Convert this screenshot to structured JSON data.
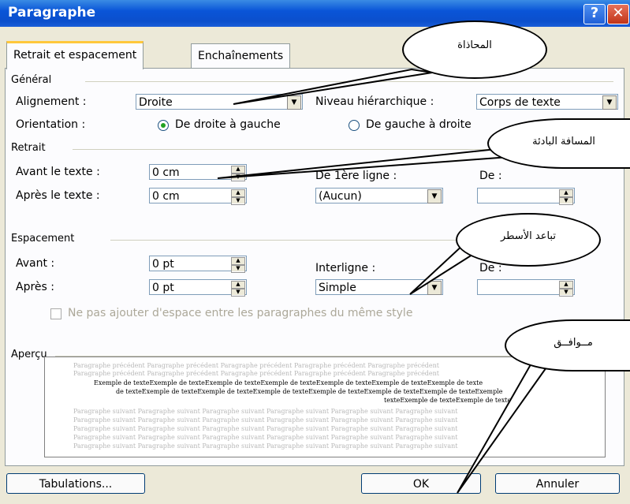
{
  "window": {
    "title": "Paragraphe",
    "help_glyph": "?",
    "close_glyph": "✕"
  },
  "tabs": [
    {
      "label": "Retrait et espacement",
      "active": true
    },
    {
      "label": "Enchaînements",
      "active": false
    }
  ],
  "general": {
    "group_label": "Général",
    "alignment_label": "Alignement :",
    "alignment_value": "Droite",
    "level_label": "Niveau hiérarchique :",
    "level_value": "Corps de texte",
    "orientation_label": "Orientation :",
    "orientation_rtl": "De droite à gauche",
    "orientation_ltr": "De gauche à droite"
  },
  "indent": {
    "group_label": "Retrait",
    "before_label": "Avant le texte :",
    "before_value": "0 cm",
    "after_label": "Après le texte :",
    "after_value": "0 cm",
    "first_line_label": "De 1ère ligne :",
    "first_line_value": "(Aucun)",
    "by_label": "De :",
    "by_value": ""
  },
  "spacing": {
    "group_label": "Espacement",
    "before_label": "Avant :",
    "before_value": "0 pt",
    "after_label": "Après :",
    "after_value": "0 pt",
    "line_label": "Interligne :",
    "line_value": "Simple",
    "at_label": "De :",
    "at_value": "",
    "no_space_label": "Ne pas ajouter d'espace entre les paragraphes du même style"
  },
  "preview": {
    "group_label": "Aperçu",
    "prev_line": "Paragraphe précédent Paragraphe précédent Paragraphe précédent Paragraphe précédent Paragraphe précédent",
    "sample_1": "Exemple de texteExemple de texteExemple de texteExemple de texteExemple de texteExemple de texteExemple de texte",
    "sample_2": "de texteExemple de texteExemple de texteExemple de texteExemple de texteExemple de texteExemple de texteExemple",
    "sample_3": "texteExemple de texteExemple de texte",
    "next_line": "Paragraphe suivant Paragraphe suivant Paragraphe suivant Paragraphe suivant Paragraphe suivant Paragraphe suivant"
  },
  "buttons": {
    "tabs": "Tabulations...",
    "ok": "OK",
    "cancel": "Annuler"
  },
  "callouts": {
    "alignment": "المحاذاة",
    "indent": "المسافة البادئة",
    "line_spacing": "تباعد الأسطر",
    "ok": "مــوافــق"
  }
}
